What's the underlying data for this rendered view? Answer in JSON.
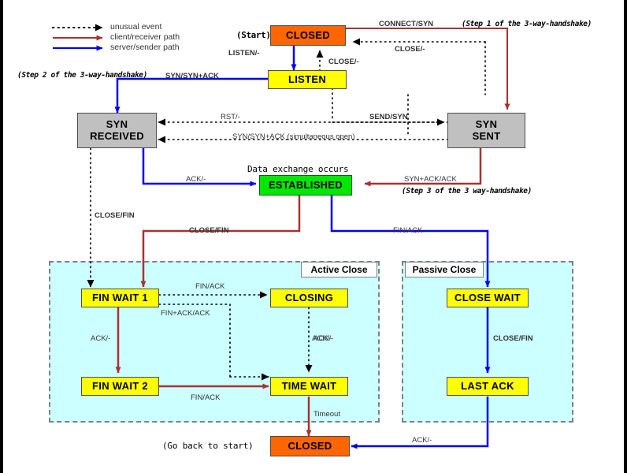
{
  "legend": {
    "items": [
      {
        "name": "unusual-event",
        "label": "unusual event",
        "style": "dotted",
        "color": "#000000"
      },
      {
        "name": "client-receiver-path",
        "label": "client/receiver path",
        "style": "solid",
        "color": "#a83232"
      },
      {
        "name": "server-sender-path",
        "label": "server/sender path",
        "style": "solid",
        "color": "#0000ee"
      }
    ]
  },
  "states": {
    "closed_top": "CLOSED",
    "listen": "LISTEN",
    "syn_received_l1": "SYN",
    "syn_received_l2": "RECEIVED",
    "syn_sent_l1": "SYN",
    "syn_sent_l2": "SENT",
    "established": "ESTABLISHED",
    "fin_wait_1": "FIN WAIT 1",
    "fin_wait_2": "FIN WAIT 2",
    "closing": "CLOSING",
    "time_wait": "TIME WAIT",
    "close_wait": "CLOSE WAIT",
    "last_ack": "LAST ACK",
    "closed_bottom": "CLOSED"
  },
  "annotations": {
    "start": "(Start)",
    "go_back_to_start": "(Go back to start)",
    "data_exchange": "Data exchange occurs",
    "step1": "(Step 1 of the 3-way-handshake)",
    "step2": "(Step 2 of the 3-way-handshake)",
    "step3": "(Step 3 of the 3 way-handshake)"
  },
  "regions": {
    "active_close": "Active Close",
    "passive_close": "Passive Close"
  },
  "transitions": {
    "connect_syn": "CONNECT/SYN",
    "close_dash_top": "CLOSE/-",
    "close_dash_right": "CLOSE/-",
    "listen_dash": "LISTEN/-",
    "close_dash_mid": "CLOSE/-",
    "syn_synack_step2": "SYN/SYN+ACK",
    "rst_dash": "RST/-",
    "send_syn": "SEND/SYN",
    "syn_synack_simultaneous": "SYN/SYN+ACK (simultaneous open)",
    "ack_dash_estab": "ACK/-",
    "synack_ack": "SYN+ACK/ACK",
    "close_fin_left": "CLOSE/FIN",
    "close_fin_mid": "CLOSE/FIN",
    "fin_ack_right": "FIN/ACK",
    "fin_ack_closing": "FIN/ACK",
    "fin_ack_ack": "FIN+ACK/ACK",
    "ack_dash_fw": "ACK/-",
    "ack_dash_closing": "ACK/-",
    "fin_ack_tw": "FIN/ACK",
    "ack_dash_tw": "ACK/-",
    "timeout": "Timeout",
    "close_fin_passive": "CLOSE/FIN",
    "ack_dash_bottom": "ACK/-"
  },
  "colors": {
    "closed": "#ff6600",
    "listen": "#ffff00",
    "gray_state": "#c0c0c0",
    "established": "#00e800",
    "region_fill": "#ccffff",
    "client_path": "#a83232",
    "server_path": "#0000ee",
    "unusual_path": "#000000"
  }
}
